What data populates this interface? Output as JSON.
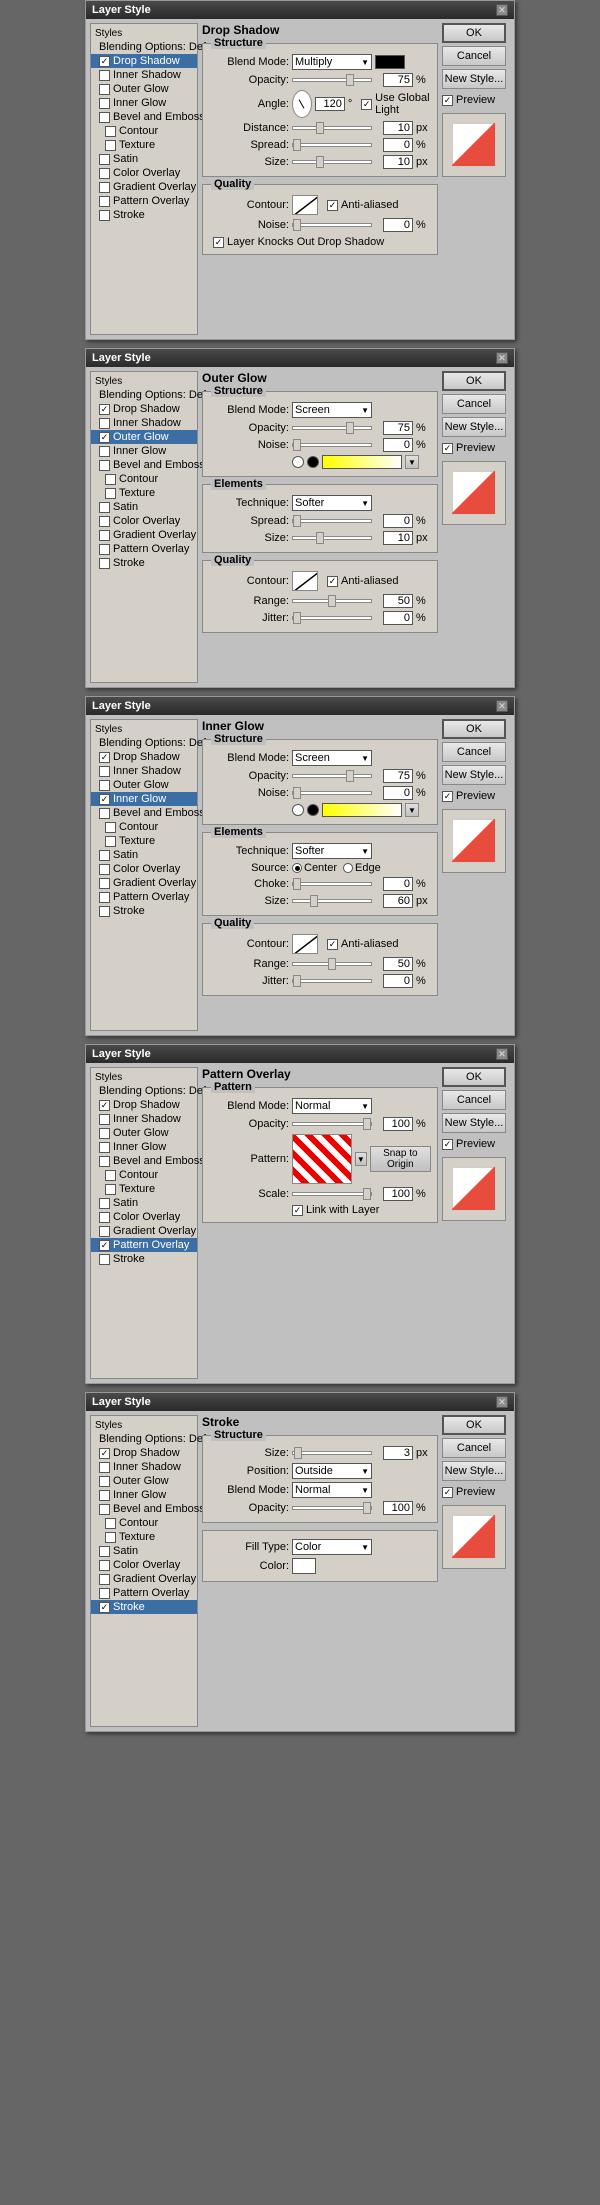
{
  "windows": [
    {
      "id": "drop-shadow",
      "title": "Layer Style",
      "sidebar": {
        "label": "Styles",
        "items": [
          {
            "id": "blending-options",
            "label": "Blending Options: Default",
            "checked": false,
            "active": false,
            "indent": false
          },
          {
            "id": "drop-shadow",
            "label": "Drop Shadow",
            "checked": true,
            "active": true,
            "indent": false
          },
          {
            "id": "inner-shadow",
            "label": "Inner Shadow",
            "checked": false,
            "active": false,
            "indent": false
          },
          {
            "id": "outer-glow",
            "label": "Outer Glow",
            "checked": false,
            "active": false,
            "indent": false
          },
          {
            "id": "inner-glow",
            "label": "Inner Glow",
            "checked": false,
            "active": false,
            "indent": false
          },
          {
            "id": "bevel-emboss",
            "label": "Bevel and Emboss",
            "checked": false,
            "active": false,
            "indent": false
          },
          {
            "id": "contour",
            "label": "Contour",
            "checked": false,
            "active": false,
            "indent": true
          },
          {
            "id": "texture",
            "label": "Texture",
            "checked": false,
            "active": false,
            "indent": true
          },
          {
            "id": "satin",
            "label": "Satin",
            "checked": false,
            "active": false,
            "indent": false
          },
          {
            "id": "color-overlay",
            "label": "Color Overlay",
            "checked": false,
            "active": false,
            "indent": false
          },
          {
            "id": "gradient-overlay",
            "label": "Gradient Overlay",
            "checked": false,
            "active": false,
            "indent": false
          },
          {
            "id": "pattern-overlay",
            "label": "Pattern Overlay",
            "checked": false,
            "active": false,
            "indent": false
          },
          {
            "id": "stroke",
            "label": "Stroke",
            "checked": false,
            "active": false,
            "indent": false
          }
        ]
      },
      "panel": {
        "name": "Drop Shadow",
        "sections": [
          {
            "title": "Structure",
            "rows": [
              {
                "label": "Blend Mode:",
                "type": "dropdown-color",
                "value": "Multiply",
                "color": "#000000"
              },
              {
                "label": "Opacity:",
                "type": "slider",
                "value": "75",
                "unit": "%"
              },
              {
                "label": "Angle:",
                "type": "angle",
                "value": "120",
                "useGlobal": true
              },
              {
                "label": "Distance:",
                "type": "slider",
                "value": "10",
                "unit": "px"
              },
              {
                "label": "Spread:",
                "type": "slider",
                "value": "0",
                "unit": "%"
              },
              {
                "label": "Size:",
                "type": "slider",
                "value": "10",
                "unit": "px"
              }
            ]
          },
          {
            "title": "Quality",
            "rows": [
              {
                "label": "Contour:",
                "type": "contour",
                "antiAliased": true
              },
              {
                "label": "Noise:",
                "type": "slider",
                "value": "0",
                "unit": "%"
              }
            ],
            "knocksOut": true
          }
        ]
      },
      "buttons": {
        "ok": "OK",
        "cancel": "Cancel",
        "newStyle": "New Style...",
        "preview": true
      }
    },
    {
      "id": "outer-glow",
      "title": "Layer Style",
      "sidebar": {
        "label": "Styles",
        "items": [
          {
            "id": "blending-options",
            "label": "Blending Options: Default",
            "checked": false,
            "active": false,
            "indent": false
          },
          {
            "id": "drop-shadow",
            "label": "Drop Shadow",
            "checked": true,
            "active": false,
            "indent": false
          },
          {
            "id": "inner-shadow",
            "label": "Inner Shadow",
            "checked": false,
            "active": false,
            "indent": false
          },
          {
            "id": "outer-glow",
            "label": "Outer Glow",
            "checked": true,
            "active": true,
            "indent": false
          },
          {
            "id": "inner-glow",
            "label": "Inner Glow",
            "checked": false,
            "active": false,
            "indent": false
          },
          {
            "id": "bevel-emboss",
            "label": "Bevel and Emboss",
            "checked": false,
            "active": false,
            "indent": false
          },
          {
            "id": "contour",
            "label": "Contour",
            "checked": false,
            "active": false,
            "indent": true
          },
          {
            "id": "texture",
            "label": "Texture",
            "checked": false,
            "active": false,
            "indent": true
          },
          {
            "id": "satin",
            "label": "Satin",
            "checked": false,
            "active": false,
            "indent": false
          },
          {
            "id": "color-overlay",
            "label": "Color Overlay",
            "checked": false,
            "active": false,
            "indent": false
          },
          {
            "id": "gradient-overlay",
            "label": "Gradient Overlay",
            "checked": false,
            "active": false,
            "indent": false
          },
          {
            "id": "pattern-overlay",
            "label": "Pattern Overlay",
            "checked": false,
            "active": false,
            "indent": false
          },
          {
            "id": "stroke",
            "label": "Stroke",
            "checked": false,
            "active": false,
            "indent": false
          }
        ]
      },
      "panel": {
        "name": "Outer Glow"
      },
      "buttons": {
        "ok": "OK",
        "cancel": "Cancel",
        "newStyle": "New Style...",
        "preview": true
      }
    },
    {
      "id": "inner-glow",
      "title": "Layer Style",
      "sidebar": {
        "label": "Styles",
        "items": [
          {
            "id": "blending-options",
            "label": "Blending Options: Default",
            "checked": false,
            "active": false,
            "indent": false
          },
          {
            "id": "drop-shadow",
            "label": "Drop Shadow",
            "checked": true,
            "active": false,
            "indent": false
          },
          {
            "id": "inner-shadow",
            "label": "Inner Shadow",
            "checked": false,
            "active": false,
            "indent": false
          },
          {
            "id": "outer-glow",
            "label": "Outer Glow",
            "checked": false,
            "active": false,
            "indent": false
          },
          {
            "id": "inner-glow",
            "label": "Inner Glow",
            "checked": true,
            "active": true,
            "indent": false
          },
          {
            "id": "bevel-emboss",
            "label": "Bevel and Emboss",
            "checked": false,
            "active": false,
            "indent": false
          },
          {
            "id": "contour",
            "label": "Contour",
            "checked": false,
            "active": false,
            "indent": true
          },
          {
            "id": "texture",
            "label": "Texture",
            "checked": false,
            "active": false,
            "indent": true
          },
          {
            "id": "satin",
            "label": "Satin",
            "checked": false,
            "active": false,
            "indent": false
          },
          {
            "id": "color-overlay",
            "label": "Color Overlay",
            "checked": false,
            "active": false,
            "indent": false
          },
          {
            "id": "gradient-overlay",
            "label": "Gradient Overlay",
            "checked": false,
            "active": false,
            "indent": false
          },
          {
            "id": "pattern-overlay",
            "label": "Pattern Overlay",
            "checked": false,
            "active": false,
            "indent": false
          },
          {
            "id": "stroke",
            "label": "Stroke",
            "checked": false,
            "active": false,
            "indent": false
          }
        ]
      },
      "panel": {
        "name": "Inner Glow"
      },
      "buttons": {
        "ok": "OK",
        "cancel": "Cancel",
        "newStyle": "New Style...",
        "preview": true
      }
    },
    {
      "id": "pattern-overlay",
      "title": "Layer Style",
      "sidebar": {
        "label": "Styles",
        "items": [
          {
            "id": "blending-options",
            "label": "Blending Options: Default",
            "checked": false,
            "active": false,
            "indent": false
          },
          {
            "id": "drop-shadow",
            "label": "Drop Shadow",
            "checked": true,
            "active": false,
            "indent": false
          },
          {
            "id": "inner-shadow",
            "label": "Inner Shadow",
            "checked": false,
            "active": false,
            "indent": false
          },
          {
            "id": "outer-glow",
            "label": "Outer Glow",
            "checked": false,
            "active": false,
            "indent": false
          },
          {
            "id": "inner-glow",
            "label": "Inner Glow",
            "checked": false,
            "active": false,
            "indent": false
          },
          {
            "id": "bevel-emboss",
            "label": "Bevel and Emboss",
            "checked": false,
            "active": false,
            "indent": false
          },
          {
            "id": "contour",
            "label": "Contour",
            "checked": false,
            "active": false,
            "indent": true
          },
          {
            "id": "texture",
            "label": "Texture",
            "checked": false,
            "active": false,
            "indent": true
          },
          {
            "id": "satin",
            "label": "Satin",
            "checked": false,
            "active": false,
            "indent": false
          },
          {
            "id": "color-overlay",
            "label": "Color Overlay",
            "checked": false,
            "active": false,
            "indent": false
          },
          {
            "id": "gradient-overlay",
            "label": "Gradient Overlay",
            "checked": false,
            "active": false,
            "indent": false
          },
          {
            "id": "pattern-overlay",
            "label": "Pattern Overlay",
            "checked": true,
            "active": true,
            "indent": false
          },
          {
            "id": "stroke",
            "label": "Stroke",
            "checked": false,
            "active": false,
            "indent": false
          }
        ]
      },
      "panel": {
        "name": "Pattern Overlay"
      },
      "buttons": {
        "ok": "OK",
        "cancel": "Cancel",
        "newStyle": "New Style...",
        "preview": true
      }
    },
    {
      "id": "stroke",
      "title": "Layer Style",
      "sidebar": {
        "label": "Styles",
        "items": [
          {
            "id": "blending-options",
            "label": "Blending Options: Default",
            "checked": false,
            "active": false,
            "indent": false
          },
          {
            "id": "drop-shadow",
            "label": "Drop Shadow",
            "checked": true,
            "active": false,
            "indent": false
          },
          {
            "id": "inner-shadow",
            "label": "Inner Shadow",
            "checked": false,
            "active": false,
            "indent": false
          },
          {
            "id": "outer-glow",
            "label": "Outer Glow",
            "checked": false,
            "active": false,
            "indent": false
          },
          {
            "id": "inner-glow",
            "label": "Inner Glow",
            "checked": false,
            "active": false,
            "indent": false
          },
          {
            "id": "bevel-emboss",
            "label": "Bevel and Emboss",
            "checked": false,
            "active": false,
            "indent": false
          },
          {
            "id": "contour",
            "label": "Contour",
            "checked": false,
            "active": false,
            "indent": true
          },
          {
            "id": "texture",
            "label": "Texture",
            "checked": false,
            "active": false,
            "indent": true
          },
          {
            "id": "satin",
            "label": "Satin",
            "checked": false,
            "active": false,
            "indent": false
          },
          {
            "id": "color-overlay",
            "label": "Color Overlay",
            "checked": false,
            "active": false,
            "indent": false
          },
          {
            "id": "gradient-overlay",
            "label": "Gradient Overlay",
            "checked": false,
            "active": false,
            "indent": false
          },
          {
            "id": "pattern-overlay",
            "label": "Pattern Overlay",
            "checked": false,
            "active": false,
            "indent": false
          },
          {
            "id": "stroke",
            "label": "Stroke",
            "checked": true,
            "active": true,
            "indent": false
          }
        ]
      },
      "panel": {
        "name": "Stroke"
      },
      "buttons": {
        "ok": "OK",
        "cancel": "Cancel",
        "newStyle": "New Style...",
        "preview": true
      }
    }
  ],
  "labels": {
    "ok": "OK",
    "cancel": "Cancel",
    "newStyle": "New Style...",
    "preview": "Preview",
    "structure": "Structure",
    "quality": "Quality",
    "elements": "Elements",
    "blendMode": "Blend Mode:",
    "opacity": "Opacity:",
    "angle": "Angle:",
    "distance": "Distance:",
    "spread": "Spread:",
    "size": "Size:",
    "contour": "Contour:",
    "noise": "Noise:",
    "useGlobalLight": "Use Global Light",
    "antiAliased": "Anti-aliased",
    "layerKnocksOut": "Layer Knocks Out Drop Shadow",
    "technique": "Technique:",
    "softer": "Softer",
    "range": "Range:",
    "jitter": "Jitter:",
    "source": "Source:",
    "center": "Center",
    "edge": "Edge",
    "choke": "Choke:",
    "pattern": "Pattern",
    "scale": "Scale:",
    "snapToOrigin": "Snap to Origin",
    "linkWithLayer": "Link with Layer",
    "normal": "Normal",
    "position": "Position:",
    "outside": "Outside",
    "fillType": "Fill Type:",
    "color": "Color",
    "colorLabel": "Color:"
  }
}
